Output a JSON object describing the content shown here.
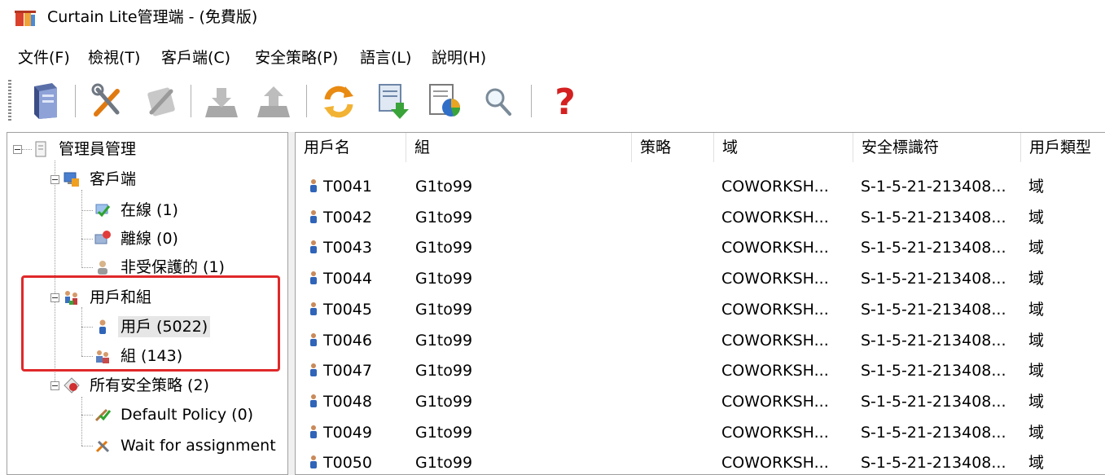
{
  "window": {
    "title": "Curtain Lite管理端 - (免費版)"
  },
  "menu": [
    "文件(F)",
    "檢視(T)",
    "客戶端(C)",
    "安全策略(P)",
    "語言(L)",
    "說明(H)"
  ],
  "toolbar": {
    "buttons": [
      "server-icon",
      "tools-icon",
      "tools-disabled-icon",
      "download-disabled-icon",
      "upload-disabled-icon",
      "refresh-icon",
      "export-icon",
      "report-chart-icon",
      "search-icon",
      "help-icon"
    ]
  },
  "tree": {
    "root": "管理員管理",
    "clients": "客戶端",
    "online": "在線 (1)",
    "offline": "離線 (0)",
    "unprotected": "非受保護的 (1)",
    "users_groups": "用戶和組",
    "users": "用戶 (5022)",
    "groups": "組 (143)",
    "policies": "所有安全策略 (2)",
    "default_policy": "Default Policy (0)",
    "wait_assignment": "Wait for assignment"
  },
  "list": {
    "columns": [
      "用戶名",
      "組",
      "策略",
      "域",
      "安全標識符",
      "用戶類型"
    ],
    "rows": [
      {
        "name": "T0041",
        "group": "G1to99",
        "policy": "",
        "domain": "COWORKSH...",
        "sid": "S-1-5-21-213408...",
        "type": "域"
      },
      {
        "name": "T0042",
        "group": "G1to99",
        "policy": "",
        "domain": "COWORKSH...",
        "sid": "S-1-5-21-213408...",
        "type": "域"
      },
      {
        "name": "T0043",
        "group": "G1to99",
        "policy": "",
        "domain": "COWORKSH...",
        "sid": "S-1-5-21-213408...",
        "type": "域"
      },
      {
        "name": "T0044",
        "group": "G1to99",
        "policy": "",
        "domain": "COWORKSH...",
        "sid": "S-1-5-21-213408...",
        "type": "域"
      },
      {
        "name": "T0045",
        "group": "G1to99",
        "policy": "",
        "domain": "COWORKSH...",
        "sid": "S-1-5-21-213408...",
        "type": "域"
      },
      {
        "name": "T0046",
        "group": "G1to99",
        "policy": "",
        "domain": "COWORKSH...",
        "sid": "S-1-5-21-213408...",
        "type": "域"
      },
      {
        "name": "T0047",
        "group": "G1to99",
        "policy": "",
        "domain": "COWORKSH...",
        "sid": "S-1-5-21-213408...",
        "type": "域"
      },
      {
        "name": "T0048",
        "group": "G1to99",
        "policy": "",
        "domain": "COWORKSH...",
        "sid": "S-1-5-21-213408...",
        "type": "域"
      },
      {
        "name": "T0049",
        "group": "G1to99",
        "policy": "",
        "domain": "COWORKSH...",
        "sid": "S-1-5-21-213408...",
        "type": "域"
      },
      {
        "name": "T0050",
        "group": "G1to99",
        "policy": "",
        "domain": "COWORKSH...",
        "sid": "S-1-5-21-213408...",
        "type": "域"
      }
    ]
  },
  "colors": {
    "highlight_box": "#e0282a",
    "selection": "#e6e6e6"
  }
}
